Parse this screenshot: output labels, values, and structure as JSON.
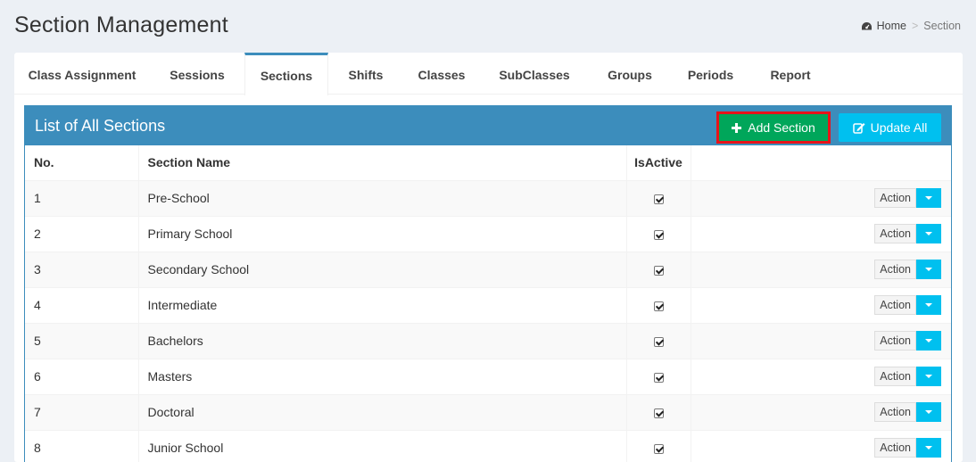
{
  "page": {
    "title": "Section Management",
    "breadcrumb": {
      "home": "Home",
      "current": "Section",
      "separator": ">"
    }
  },
  "tabs": [
    {
      "label": "Class Assignment",
      "active": false
    },
    {
      "label": "Sessions",
      "active": false
    },
    {
      "label": "Sections",
      "active": true
    },
    {
      "label": "Shifts",
      "active": false
    },
    {
      "label": "Classes",
      "active": false
    },
    {
      "label": "SubClasses",
      "active": false
    },
    {
      "label": "Groups",
      "active": false
    },
    {
      "label": "Periods",
      "active": false
    },
    {
      "label": "Report",
      "active": false
    }
  ],
  "panel": {
    "title": "List of All Sections",
    "add_label": "Add Section",
    "update_label": "Update All"
  },
  "table": {
    "headers": {
      "no": "No.",
      "name": "Section Name",
      "active": "IsActive",
      "action": ""
    },
    "action_label": "Action",
    "rows": [
      {
        "no": "1",
        "name": "Pre-School",
        "active": true
      },
      {
        "no": "2",
        "name": "Primary School",
        "active": true
      },
      {
        "no": "3",
        "name": "Secondary School",
        "active": true
      },
      {
        "no": "4",
        "name": "Intermediate",
        "active": true
      },
      {
        "no": "5",
        "name": "Bachelors",
        "active": true
      },
      {
        "no": "6",
        "name": "Masters",
        "active": true
      },
      {
        "no": "7",
        "name": "Doctoral",
        "active": true
      },
      {
        "no": "8",
        "name": "Junior School",
        "active": true
      }
    ]
  },
  "colors": {
    "primary": "#3c8dbc",
    "success": "#00a65a",
    "info": "#00c0ef",
    "highlight": "#e8131a"
  },
  "icons": {
    "home": "dashboard-icon",
    "add": "plus-icon",
    "update": "edit-icon",
    "caret": "caret-down-icon"
  }
}
